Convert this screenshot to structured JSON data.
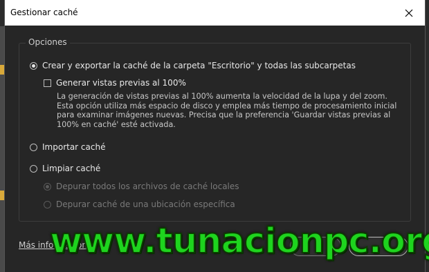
{
  "dialog": {
    "title": "Gestionar caché",
    "close_icon": "close-icon"
  },
  "options": {
    "group_label": "Opciones",
    "create_export": {
      "label": "Crear y exportar la caché de la carpeta \"Escritorio\" y todas las subcarpetas",
      "selected": true
    },
    "generate_previews": {
      "label": "Generar vistas previas al 100%",
      "checked": false,
      "description": "La generación de vistas previas al 100% aumenta la velocidad de la lupa y del zoom. Esta opción utiliza más espacio de disco y emplea más tiempo de procesamiento inicial para examinar imágenes nuevas. Precisa que la preferencia 'Guardar vistas previas al 100% en caché' esté activada."
    },
    "import_cache": {
      "label": "Importar caché",
      "selected": false
    },
    "clear_cache": {
      "label": "Limpiar caché",
      "selected": false
    },
    "purge_all_local": {
      "label": "Depurar todos los archivos de caché locales",
      "selected": true,
      "enabled": false
    },
    "purge_location": {
      "label": "Depurar caché de una ubicación específica",
      "selected": false,
      "enabled": false
    }
  },
  "footer": {
    "more_info": "Más información"
  },
  "watermark": "www.tunacionpc.org"
}
